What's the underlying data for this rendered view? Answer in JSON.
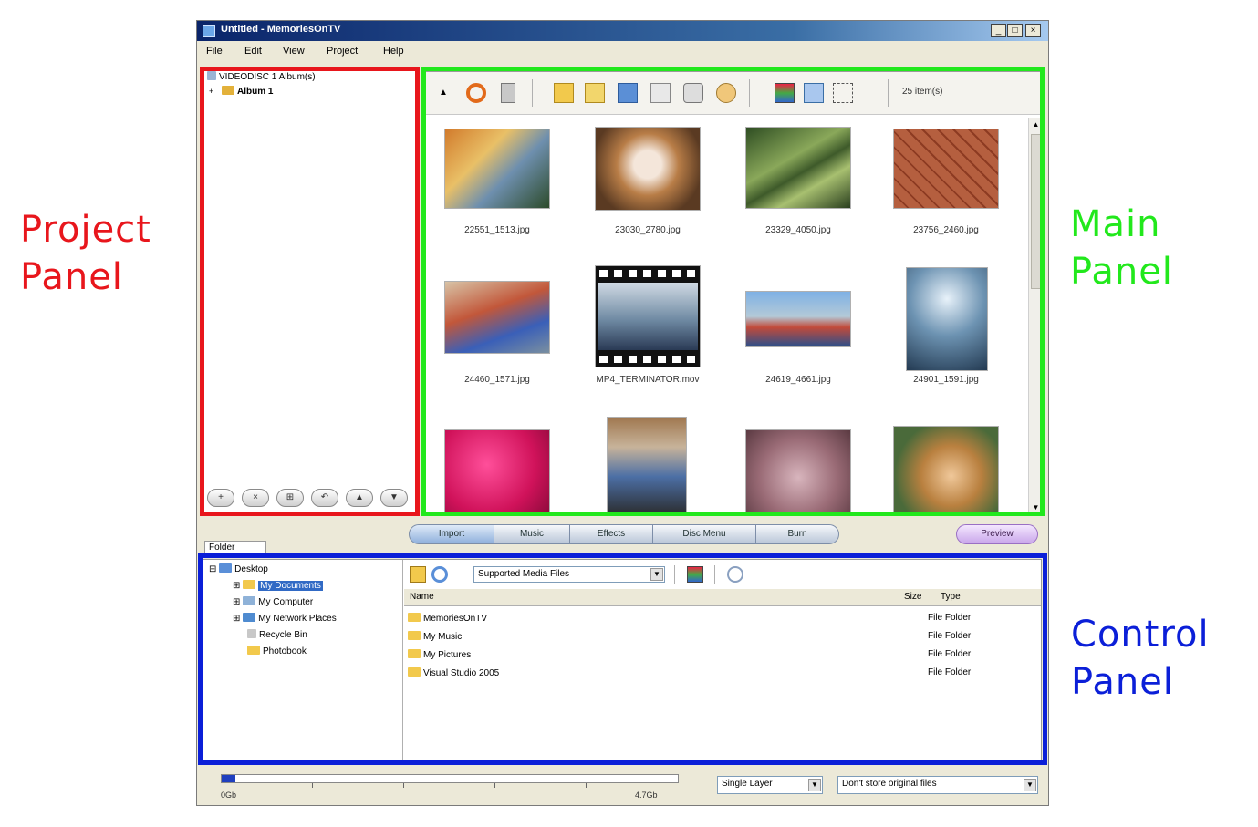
{
  "annotations": {
    "project": [
      "Project",
      "Panel"
    ],
    "main": [
      "Main",
      "Panel"
    ],
    "control": [
      "Control",
      "Panel"
    ]
  },
  "colors": {
    "project": "#e8161c",
    "main": "#22e81c",
    "control": "#0b1fd8"
  },
  "window": {
    "title": "Untitled - MemoriesOnTV",
    "menu": [
      "File",
      "Edit",
      "View",
      "Project",
      "Help"
    ]
  },
  "project_panel": {
    "root": "VIDEODISC 1 Album(s)",
    "album": "Album 1",
    "tools": [
      "+",
      "×",
      "⊞",
      "↶",
      "▲",
      "▼"
    ]
  },
  "main_panel": {
    "items_count": "25 item(s)",
    "files": [
      "22551_1513.jpg",
      "23030_2780.jpg",
      "23329_4050.jpg",
      "23756_2460.jpg",
      "24460_1571.jpg",
      "MP4_TERMINATOR.mov",
      "24619_4661.jpg",
      "24901_1591.jpg"
    ]
  },
  "tabs": [
    "Import",
    "Music",
    "Effects",
    "Disc Menu",
    "Burn"
  ],
  "preview": "Preview",
  "folder_tab": "Folder",
  "control_panel": {
    "tree": [
      "Desktop",
      "My Documents",
      "My Computer",
      "My Network Places",
      "Recycle Bin",
      "Photobook"
    ],
    "filter": "Supported Media Files",
    "headers": {
      "name": "Name",
      "size": "Size",
      "type": "Type"
    },
    "files": [
      {
        "name": "MemoriesOnTV",
        "type": "File Folder"
      },
      {
        "name": "My Music",
        "type": "File Folder"
      },
      {
        "name": "My Pictures",
        "type": "File Folder"
      },
      {
        "name": "Visual Studio 2005",
        "type": "File Folder"
      }
    ]
  },
  "status": {
    "cap_start": "0Gb",
    "cap_end": "4.7Gb",
    "capacity_used_fraction": 0.03,
    "layer": "Single Layer",
    "store": "Don't store original files"
  }
}
